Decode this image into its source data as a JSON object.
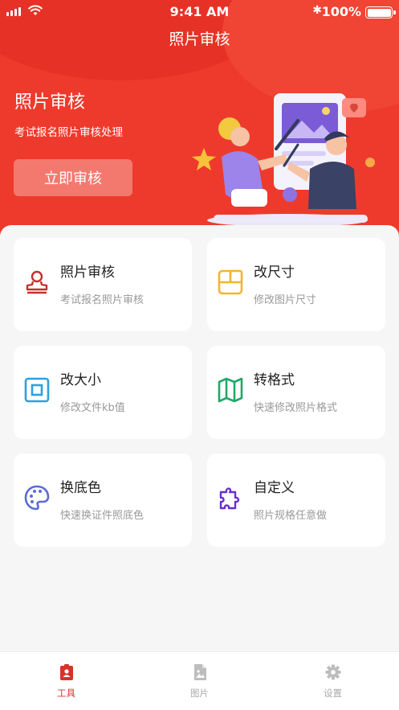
{
  "status_bar": {
    "time": "9:41 AM",
    "battery": "100%",
    "battery_level": 1.0
  },
  "header": {
    "title": "照片审核"
  },
  "hero": {
    "title": "照片审核",
    "subtitle": "考试报名照片审核处理",
    "button_label": "立即审核"
  },
  "tools": [
    {
      "title": "照片审核",
      "desc": "考试报名照片审核",
      "icon": "stamp-icon",
      "color": "#c7302a"
    },
    {
      "title": "改尺寸",
      "desc": "修改图片尺寸",
      "icon": "resize-icon",
      "color": "#f2b632"
    },
    {
      "title": "改大小",
      "desc": "修改文件kb值",
      "icon": "square-icon",
      "color": "#2ea0e0"
    },
    {
      "title": "转格式",
      "desc": "快速修改照片格式",
      "icon": "map-icon",
      "color": "#21a86a"
    },
    {
      "title": "换底色",
      "desc": "快速换证件照底色",
      "icon": "palette-icon",
      "color": "#5b6bd5"
    },
    {
      "title": "自定义",
      "desc": "照片规格任意做",
      "icon": "puzzle-icon",
      "color": "#6a2fd0"
    }
  ],
  "tabbar": [
    {
      "label": "工具",
      "icon": "id-badge-icon",
      "active": true
    },
    {
      "label": "图片",
      "icon": "image-file-icon",
      "active": false
    },
    {
      "label": "设置",
      "icon": "gear-icon",
      "active": false
    }
  ],
  "colors": {
    "brand_red": "#ee3a2c",
    "active_tab": "#d6332b"
  }
}
